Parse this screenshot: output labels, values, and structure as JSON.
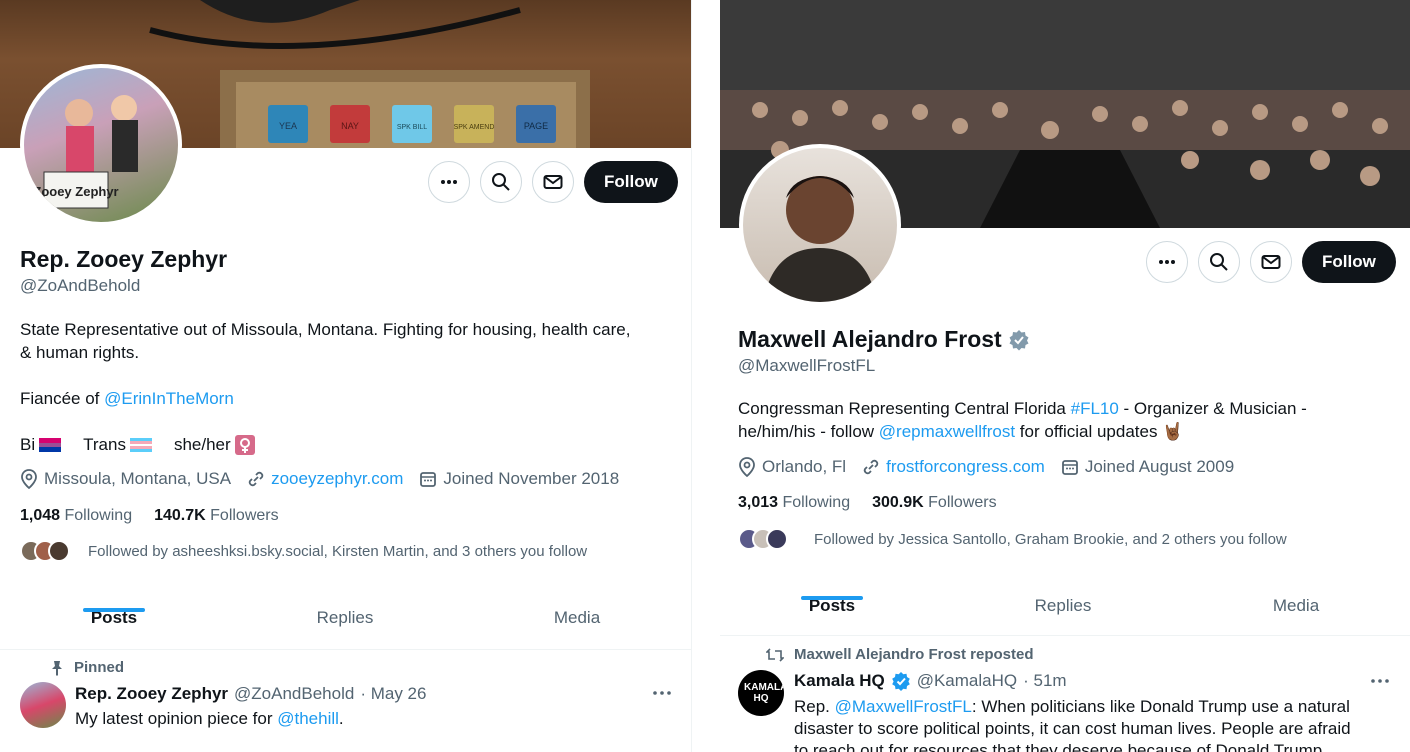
{
  "left": {
    "name": "Rep. Zooey Zephyr",
    "handle": "@ZoAndBehold",
    "bio_line1": "State Representative out of Missoula, Montana. Fighting for housing, health care,",
    "bio_line2": "& human rights.",
    "fiancee_prefix": "Fiancée of ",
    "fiancee_link": "@ErinInTheMorn",
    "identity": {
      "bi": "Bi",
      "trans": "Trans",
      "pronouns": "she/her"
    },
    "location": "Missoula, Montana, USA",
    "website": "zooeyzephyr.com",
    "joined": "Joined November 2018",
    "following_count": "1,048",
    "following_label": "Following",
    "followers_count": "140.7K",
    "followers_label": "Followers",
    "followed_by": "Followed by asheeshksi.bsky.social, Kirsten Martin, and 3 others you follow",
    "follow_label": "Follow",
    "tabs": [
      "Posts",
      "Replies",
      "Media"
    ],
    "pinned_label": "Pinned",
    "post": {
      "name": "Rep. Zooey Zephyr",
      "handle": "@ZoAndBehold",
      "date": "· May 26",
      "text": "My latest opinion piece for ",
      "link": "@thehill",
      "text_end": "."
    },
    "banner_buttons": [
      "YEA",
      "NAY",
      "SPK BILL",
      "SPK AMEND",
      "PAGE"
    ],
    "avatar_sign": "Zooey Zephyr"
  },
  "right": {
    "name": "Maxwell Alejandro Frost",
    "handle": "@MaxwellFrostFL",
    "bio_line1_a": "Congressman Representing Central Florida ",
    "bio_hashtag": "#FL10",
    "bio_line1_b": " - Organizer & Musician -",
    "bio_line2_a": "he/him/his - follow ",
    "bio_link": "@repmaxwellfrost",
    "bio_line2_b": " for official updates 🤘🏾",
    "location": "Orlando, Fl",
    "website": "frostforcongress.com",
    "joined": "Joined August 2009",
    "following_count": "3,013",
    "following_label": "Following",
    "followers_count": "300.9K",
    "followers_label": "Followers",
    "followed_by": "Followed by Jessica Santollo, Graham Brookie, and 2 others you follow",
    "follow_label": "Follow",
    "tabs": [
      "Posts",
      "Replies",
      "Media"
    ],
    "repost_label": "Maxwell Alejandro Frost reposted",
    "post": {
      "name": "Kamala HQ",
      "handle": "@KamalaHQ",
      "time": "· 51m",
      "avatar_text": "KAMALA HQ",
      "line1_a": "Rep. ",
      "line1_link": "@MaxwellFrostFL",
      "line1_b": ": When politicians like Donald Trump use a natural",
      "line2": "disaster to score political points, it can cost human lives. People are afraid",
      "line3": "to reach out for resources that they deserve because of Donald Trump"
    }
  },
  "colors": {
    "accent": "#1d9bf0",
    "text": "#0f1419",
    "muted": "#536471",
    "follow_bg": "#0f1419"
  }
}
